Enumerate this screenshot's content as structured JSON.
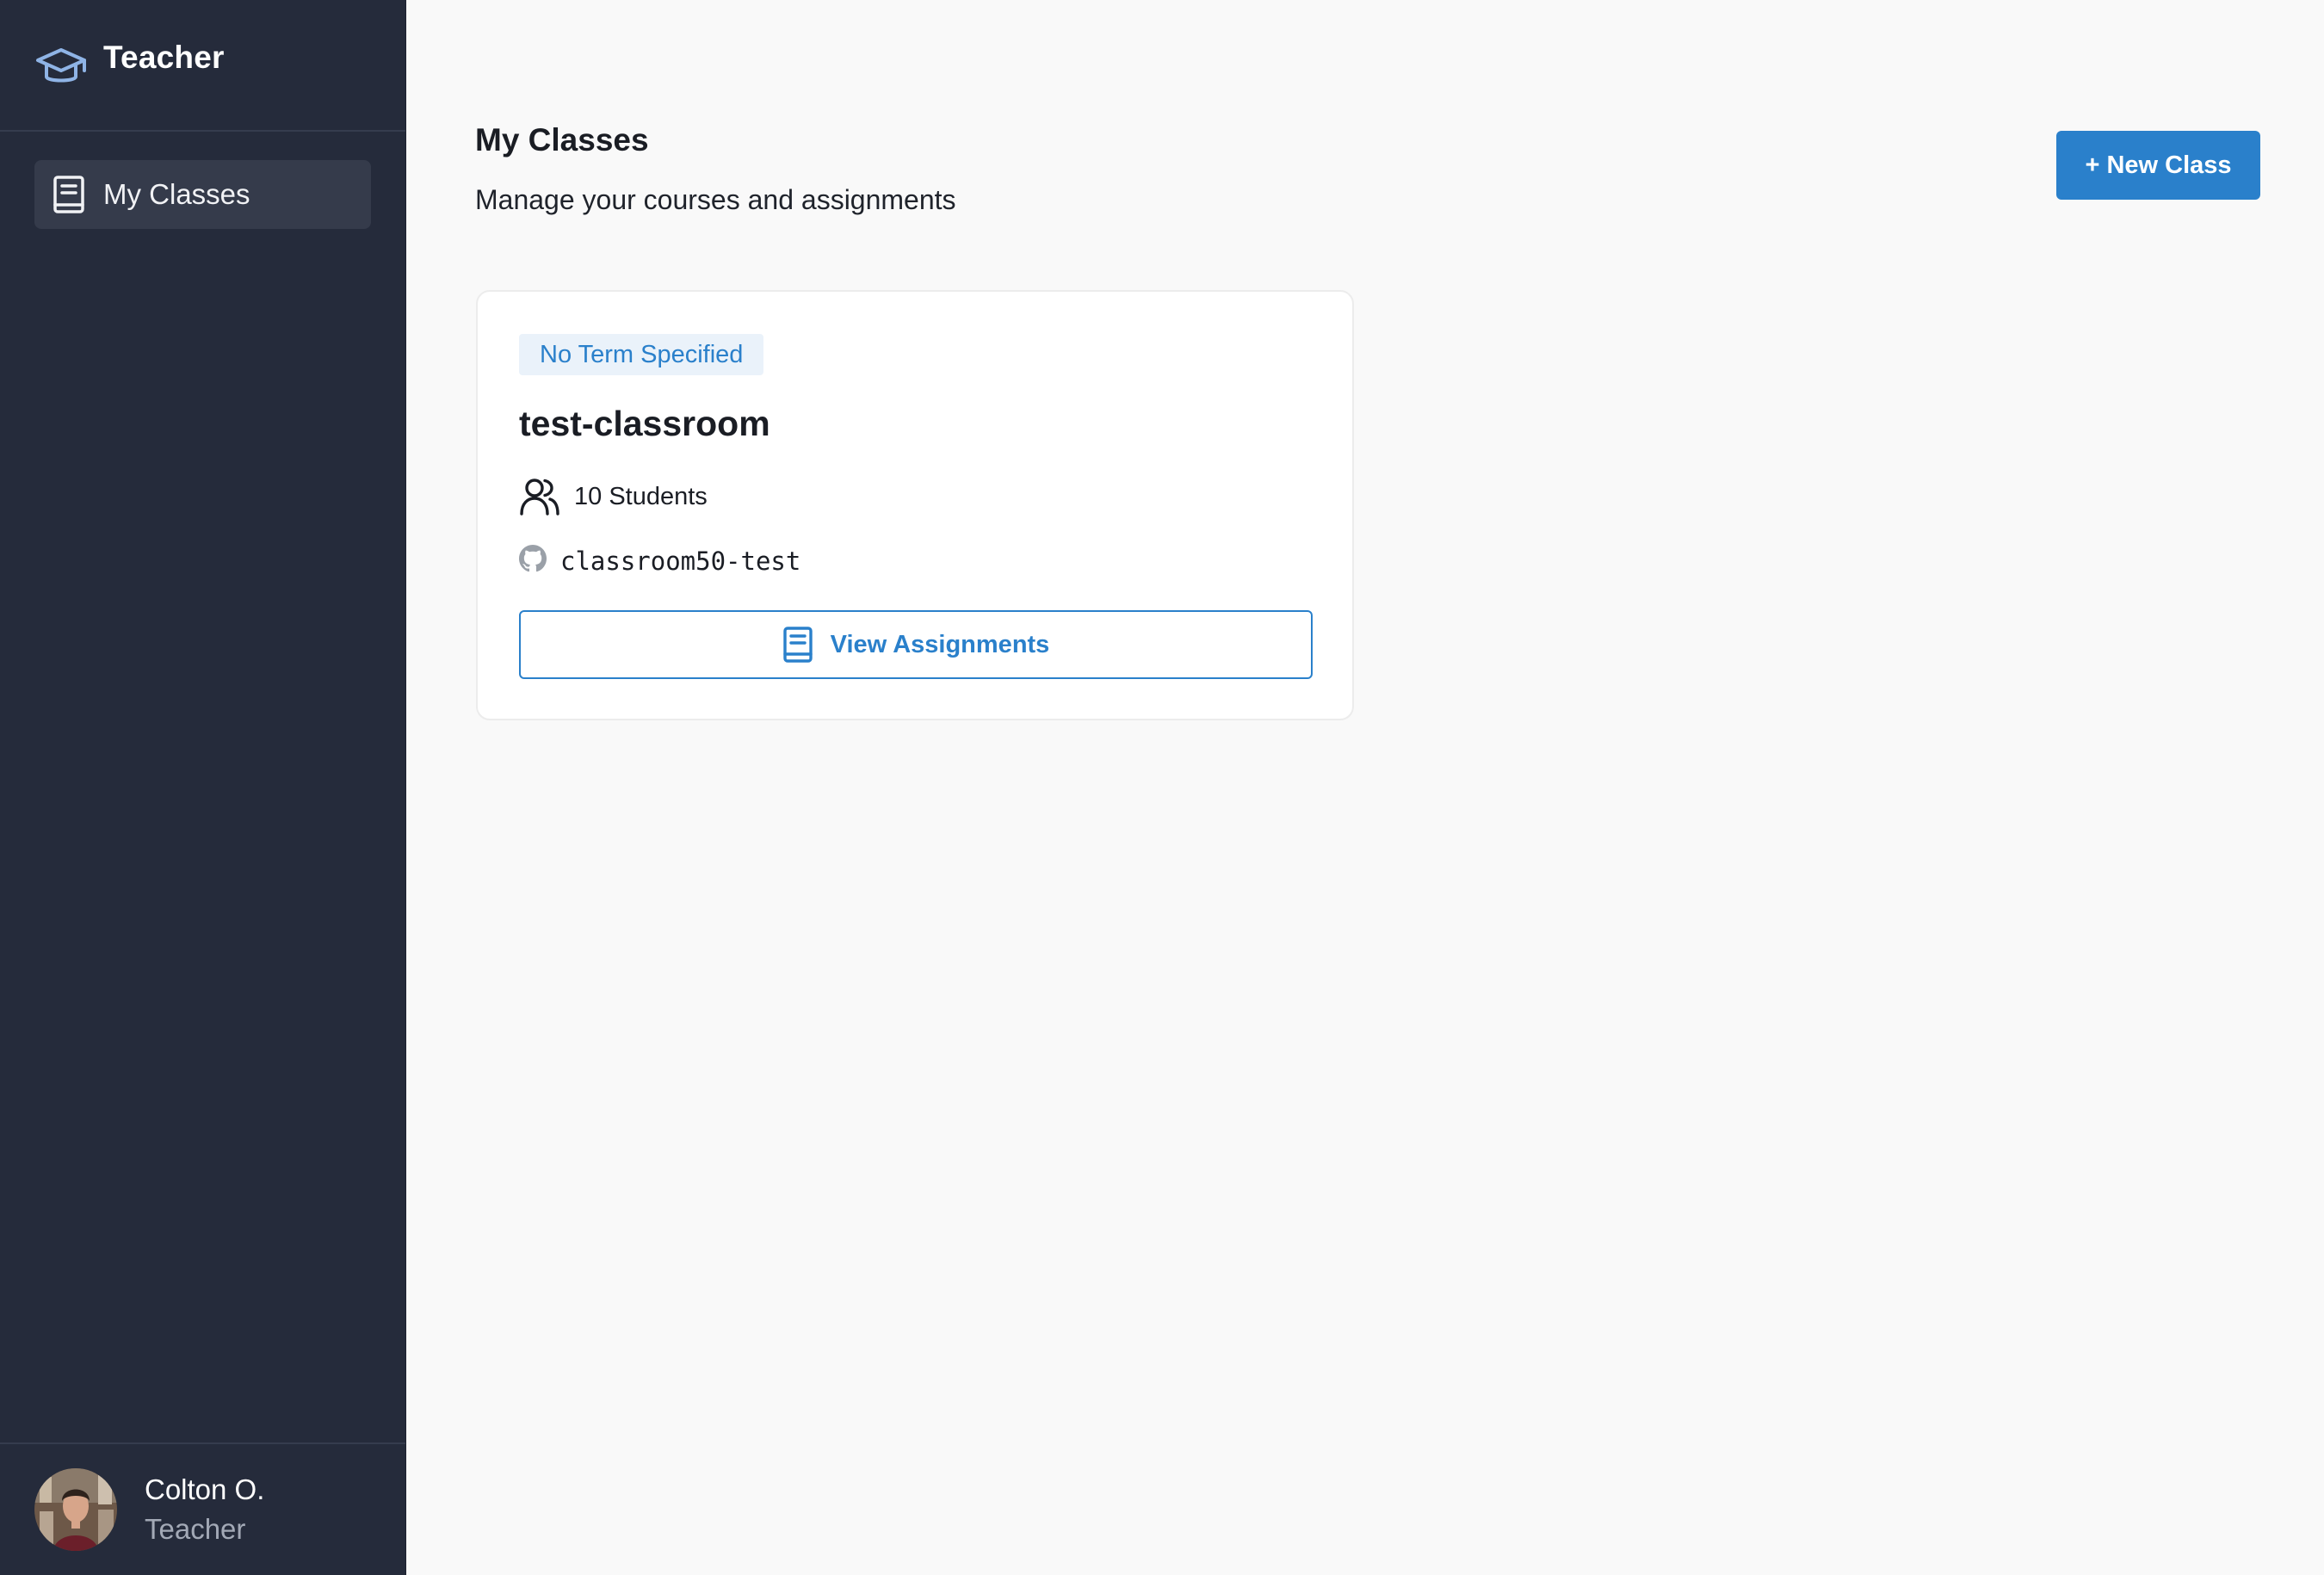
{
  "app": {
    "brand_title": "Teacher",
    "brand_icon": "graduation-cap-icon"
  },
  "sidebar": {
    "items": [
      {
        "label": "My Classes",
        "icon": "book-icon",
        "active": true
      }
    ]
  },
  "user": {
    "name": "Colton O.",
    "role": "Teacher"
  },
  "header": {
    "title": "My Classes",
    "subtitle": "Manage your courses and assignments",
    "new_class_label": "+ New Class"
  },
  "classes": [
    {
      "term": "No Term Specified",
      "name": "test-classroom",
      "students": "10 Students",
      "repo": "classroom50-test",
      "view_label": "View Assignments"
    }
  ],
  "colors": {
    "sidebar_bg": "#252b3b",
    "accent": "#2a80cb",
    "page_bg": "#f9f9f9",
    "badge_bg": "#eaf2fa"
  }
}
